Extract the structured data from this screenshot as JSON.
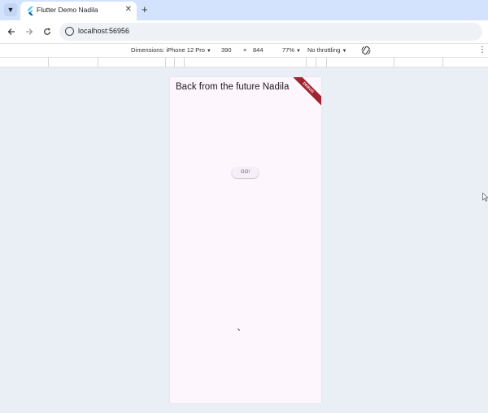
{
  "browser": {
    "tab_title": "Flutter Demo Nadila",
    "tab_close": "✕",
    "new_tab": "+",
    "url": "localhost:56956",
    "icons": {
      "tab_search": "chevron-down-icon",
      "back": "back-arrow-icon",
      "forward": "forward-arrow-icon",
      "reload": "reload-icon",
      "site_info": "site-info-icon"
    }
  },
  "devtools": {
    "dimensions_label": "Dimensions: iPhone 12 Pro",
    "width": "390",
    "times": "×",
    "height": "844",
    "zoom": "77%",
    "throttling": "No throttling",
    "more": "⋮"
  },
  "app": {
    "title": "Back from the future Nadila",
    "debug_banner": "DEBUG",
    "go_button": "GO!",
    "background_color": "#fdf6fc",
    "accent_color": "#65558f"
  }
}
